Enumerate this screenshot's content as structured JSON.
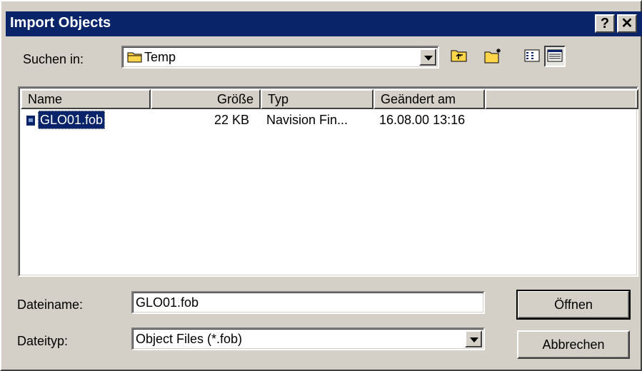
{
  "window": {
    "title": "Import Objects",
    "help_glyph": "?",
    "close_glyph": "✕"
  },
  "look_in": {
    "label": "Suchen in:",
    "value": "Temp"
  },
  "file_list": {
    "columns": [
      "Name",
      "Größe",
      "Typ",
      "Geändert am"
    ],
    "rows": [
      {
        "name": "GLO01.fob",
        "size": "22 KB",
        "type": "Navision Fin...",
        "modified": "16.08.00 13:16",
        "selected": true
      }
    ]
  },
  "file_name": {
    "label": "Dateiname:",
    "value": "GLO01.fob"
  },
  "file_type": {
    "label": "Dateityp:",
    "value": "Object Files (*.fob)"
  },
  "buttons": {
    "open": "Öffnen",
    "cancel": "Abbrechen"
  },
  "colors": {
    "titlebar": "#0a246a",
    "face": "#d4d0c8",
    "selection": "#0a246a"
  }
}
